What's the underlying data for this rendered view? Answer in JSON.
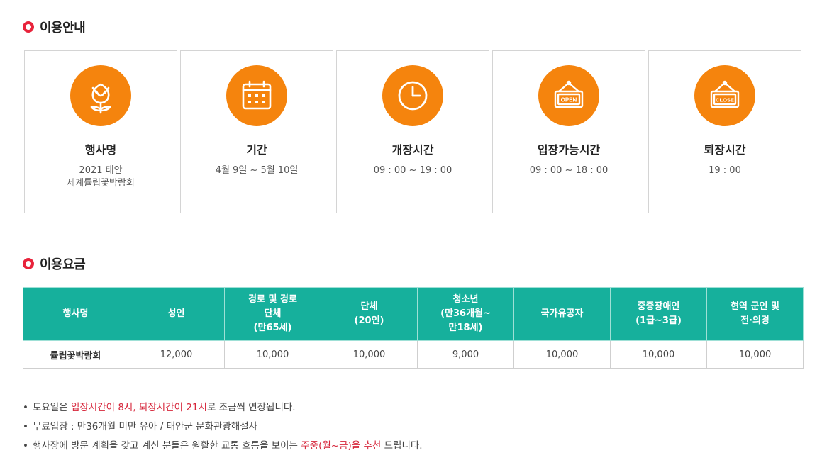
{
  "usage_info": {
    "title": "이용안내",
    "cards": [
      {
        "icon": "tulip-icon",
        "title": "행사명",
        "value_line1": "2021 태안",
        "value_line2": "세계튤립꽃박람회"
      },
      {
        "icon": "calendar-icon",
        "title": "기간",
        "value_line1": "4월 9일 ~ 5월 10일",
        "value_line2": ""
      },
      {
        "icon": "clock-icon",
        "title": "개장시간",
        "value_line1": "09 : 00 ~ 19 : 00",
        "value_line2": ""
      },
      {
        "icon": "open-sign-icon",
        "title": "입장가능시간",
        "value_line1": "09 : 00 ~ 18 : 00",
        "value_line2": "",
        "sign_text": "OPEN"
      },
      {
        "icon": "close-sign-icon",
        "title": "퇴장시간",
        "value_line1": "19 : 00",
        "value_line2": "",
        "sign_text": "CLOSE"
      }
    ]
  },
  "fees": {
    "title": "이용요금",
    "headers": [
      [
        "행사명"
      ],
      [
        "성인"
      ],
      [
        "경로 및 경로",
        "단체",
        "(만65세)"
      ],
      [
        "단체",
        "(20인)"
      ],
      [
        "청소년",
        "(만36개월~",
        "만18세)"
      ],
      [
        "국가유공자"
      ],
      [
        "중증장애인",
        "(1급~3급)"
      ],
      [
        "현역 군인 및",
        "전·의경"
      ]
    ],
    "row": [
      "튤립꽃박람회",
      "12,000",
      "10,000",
      "10,000",
      "9,000",
      "10,000",
      "10,000",
      "10,000"
    ]
  },
  "notes": {
    "n1_a": "토요일은 ",
    "n1_red": "입장시간이 8시, 퇴장시간이 21시",
    "n1_b": "로 조금씩 연장됩니다.",
    "n2": "무료입장 : 만36개월 미만 유아 / 태안군 문화관광해설사",
    "n3_a": "행사장에 방문 계획을 갖고 계신 분들은 원활한 교통 흐름을 보이는 ",
    "n3_red": "주중(월~금)을 추천",
    "n3_b": " 드립니다."
  },
  "colors": {
    "accent_orange": "#f5840d",
    "teal": "#16b09c",
    "red": "#e8233b"
  }
}
